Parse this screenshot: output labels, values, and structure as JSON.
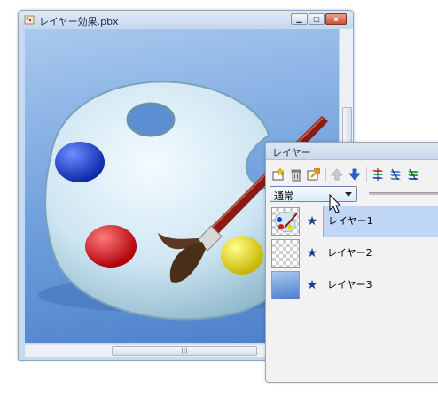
{
  "window": {
    "title": "レイヤー効果.pbx",
    "minimize_glyph": "▁",
    "maximize_glyph": "□",
    "close_glyph": "x",
    "hscroll_grip": "|||"
  },
  "layer_panel": {
    "title": "レイヤー",
    "blend_mode": "通常",
    "layers": [
      {
        "name": "レイヤー1",
        "visible_glyph": "★",
        "selected": true
      },
      {
        "name": "レイヤー2",
        "visible_glyph": "★",
        "selected": false
      },
      {
        "name": "レイヤー3",
        "visible_glyph": "★",
        "selected": false
      }
    ],
    "toolbar_icons": [
      "new-layer-icon",
      "delete-layer-icon",
      "layer-properties-icon",
      "move-up-icon",
      "move-down-icon",
      "merge-down-icon",
      "merge-visible-icon",
      "flatten-icon"
    ]
  },
  "colors": {
    "canvas_top": "#a9c9ee",
    "canvas_bottom": "#4c7fca",
    "selection": "#bfd7f4",
    "visibility_star": "#1a3e8e"
  }
}
